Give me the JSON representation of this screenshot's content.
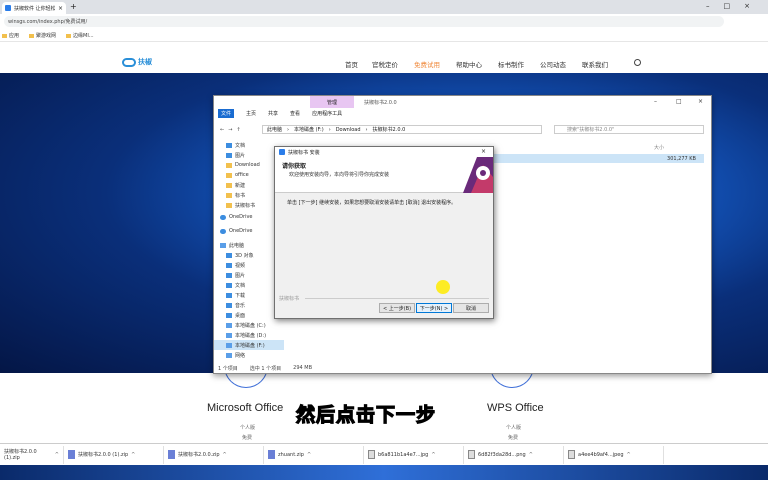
{
  "browser": {
    "tab_title": "扶椒软件 让你轻松查发",
    "url": "winsgs.com/index.php/免费试用/",
    "bookmarks": [
      "应用",
      "聚游戏网",
      "边缘MI..."
    ]
  },
  "site": {
    "nav": [
      "首页",
      "官税定价",
      "免费试用",
      "帮助中心",
      "标书制作",
      "公司动态",
      "联系我们"
    ],
    "active_nav": "免费试用"
  },
  "explorer": {
    "tools_tab": "管理",
    "title": "扶椒标书2.0.0",
    "ribbon": [
      "文件",
      "主页",
      "共享",
      "查看",
      "应用程序工具"
    ],
    "path": [
      "此电脑",
      "本地磁盘 (F:)",
      "Download",
      "扶椒标书2.0.0"
    ],
    "search_placeholder": "搜索\"扶椒标书2.0.0\"",
    "column_size": "大小",
    "file_size": "301,277 KB",
    "nav_items": [
      "文档",
      "图片",
      "Download",
      "office",
      "新建",
      "标书",
      "扶椒标书",
      "OneDrive",
      "OneDrive",
      "此电脑",
      "3D 对象",
      "视频",
      "图片",
      "文档",
      "下载",
      "音乐",
      "桌面",
      "本地磁盘 (C:)",
      "本地磁盘 (D:)",
      "本地磁盘 (F:)",
      "网络"
    ],
    "status": [
      "1 个项目",
      "选中 1 个项目",
      "294 MB"
    ]
  },
  "setup": {
    "title": "扶椒标书 安装",
    "heading": "请你获取",
    "subheading": "欢迎使用安装向导，本向导将引导你完成安装",
    "body": "单击 [下一步] 继续安装，如果您想要取消安装请单击 [取消] 退出安装程序。",
    "brand": "扶椒标书",
    "btn_back": "< 上一步(B)",
    "btn_next": "下一步(N) >",
    "btn_cancel": "取消"
  },
  "products": [
    {
      "name": "Microsoft Office",
      "sub1": "个人版",
      "sub2": "免费"
    },
    {
      "name": "WPS Office",
      "sub1": "个人版",
      "sub2": "免费"
    }
  ],
  "subtitle": "然后点击下一步",
  "downloads": [
    "扶椒标书2.0.0 (1).zip",
    "扶椒标书2.0.0 (1).zip",
    "扶椒标书2.0.0.zip",
    "zhuant.zip",
    "b6a811b1a4e7...jpg",
    "6d82f3da28d...png",
    "a4ee4b9af4...jpeg"
  ],
  "colors": {
    "accent": "#f08a3c",
    "hero": "#155cc8",
    "brand": "#2a8fd8"
  }
}
